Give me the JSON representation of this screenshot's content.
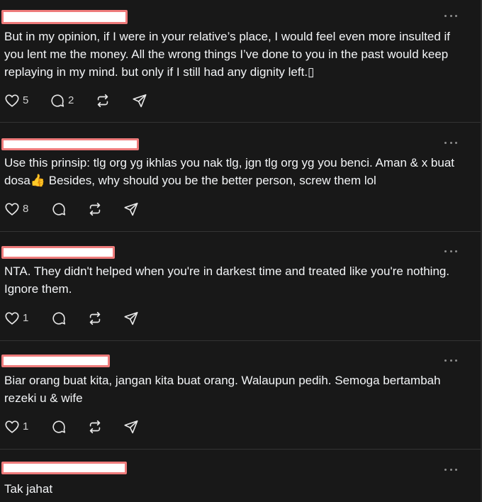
{
  "posts": [
    {
      "text": "But in my opinion, if I were in your relative’s place, I would feel even more insulted if you lent me the money. All the wrong things I’ve done to you in the past would keep replaying in my mind. but only if I still had any dignity left.▯",
      "likes": "5",
      "replies": "2"
    },
    {
      "text": "Use this prinsip: tlg org yg ikhlas you nak tlg, jgn tlg org yg you benci. Aman & x buat dosa👍 Besides, why should you be the better person, screw them lol",
      "likes": "8",
      "replies": ""
    },
    {
      "text": "NTA. They didn't helped when you're in darkest time and treated like you're nothing. Ignore them.",
      "likes": "1",
      "replies": ""
    },
    {
      "text": "Biar orang buat kita, jangan kita buat orang. Walaupun pedih. Semoga bertambah rezeki u & wife",
      "likes": "1",
      "replies": ""
    },
    {
      "text": "Tak jahat",
      "likes": "",
      "replies": ""
    }
  ],
  "icons": {
    "like": "heart-icon",
    "reply": "comment-icon",
    "repost": "repost-icon",
    "share": "send-icon",
    "more": "more-dots-icon"
  },
  "colors": {
    "background": "#181818",
    "text": "#f3f5f7",
    "redaction_border": "#ee7b7b",
    "redaction_fill": "#ffffff"
  }
}
